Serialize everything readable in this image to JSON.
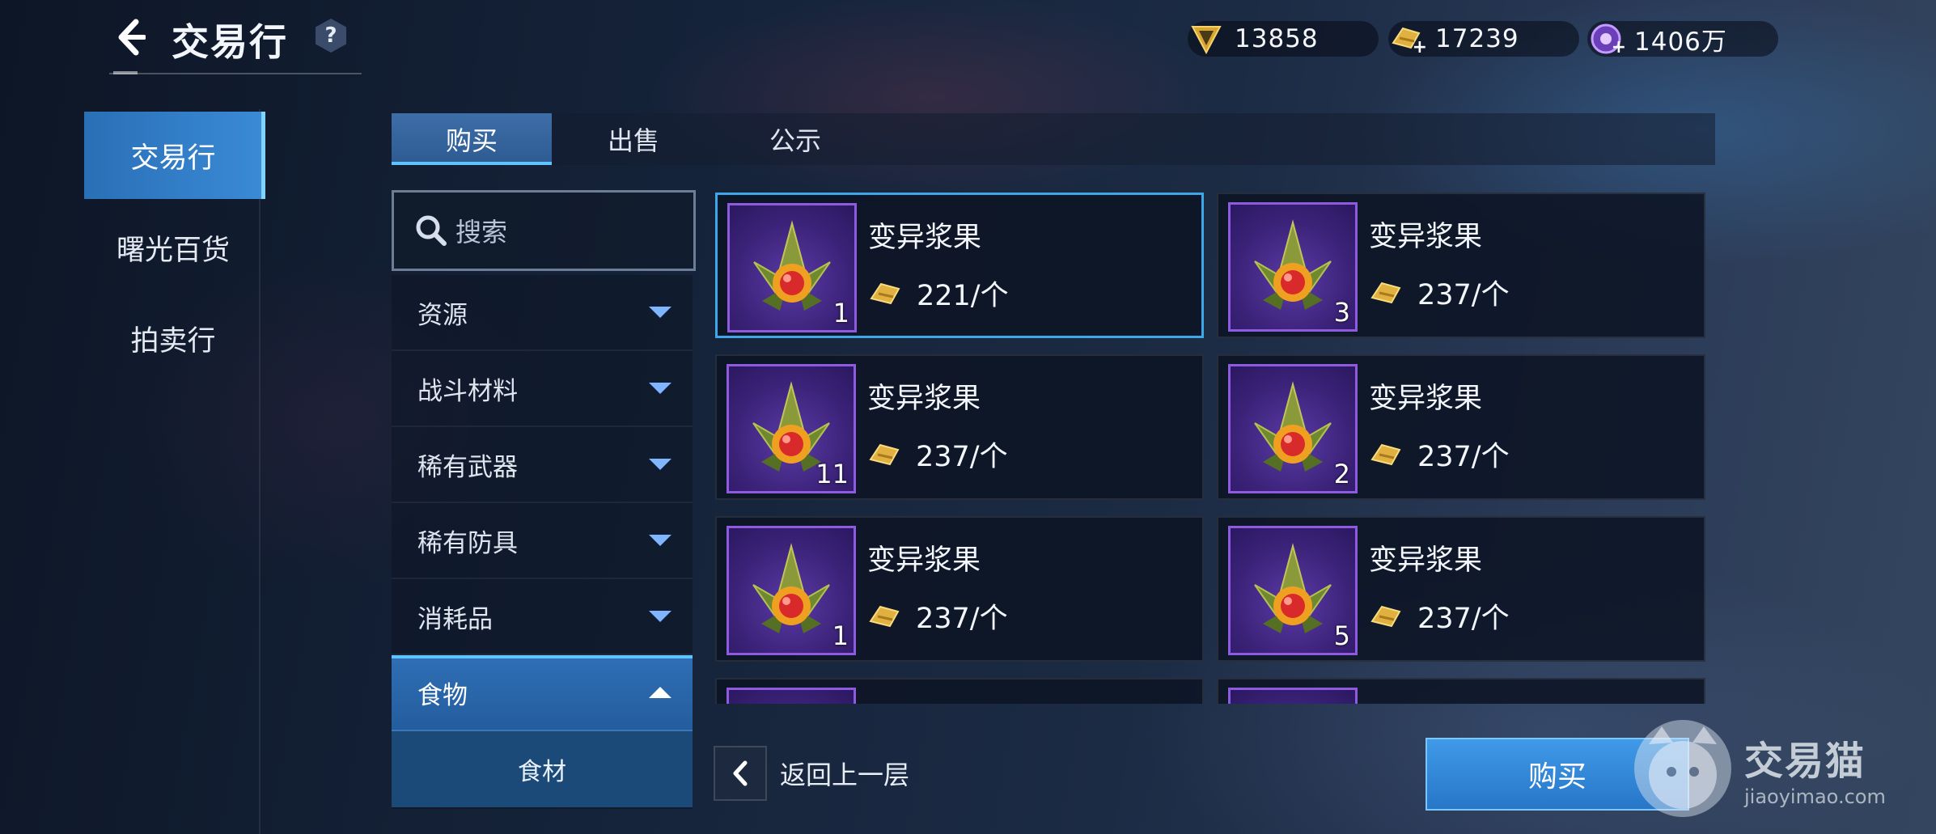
{
  "header": {
    "title": "交易行",
    "help_label": "?"
  },
  "currencies": [
    {
      "icon": "gold-triangle-coin-icon",
      "value": "13858",
      "has_plus": false
    },
    {
      "icon": "gold-bars-icon",
      "value": "17239",
      "has_plus": true
    },
    {
      "icon": "purple-crystal-icon",
      "value": "1406万",
      "has_plus": true
    }
  ],
  "sidebar": {
    "items": [
      {
        "label": "交易行",
        "active": true
      },
      {
        "label": "曙光百货",
        "active": false
      },
      {
        "label": "拍卖行",
        "active": false
      }
    ]
  },
  "tabs": [
    {
      "label": "购买",
      "active": true
    },
    {
      "label": "出售",
      "active": false
    },
    {
      "label": "公示",
      "active": false
    }
  ],
  "search": {
    "placeholder": "搜索"
  },
  "categories": [
    {
      "label": "资源",
      "expanded": false
    },
    {
      "label": "战斗材料",
      "expanded": false
    },
    {
      "label": "稀有武器",
      "expanded": false
    },
    {
      "label": "稀有防具",
      "expanded": false
    },
    {
      "label": "消耗品",
      "expanded": false
    },
    {
      "label": "食物",
      "expanded": true
    }
  ],
  "subcategory": {
    "label": "食材"
  },
  "listings": [
    {
      "name": "变异浆果",
      "price": "221/个",
      "qty": "1",
      "selected": true
    },
    {
      "name": "变异浆果",
      "price": "237/个",
      "qty": "3",
      "selected": false
    },
    {
      "name": "变异浆果",
      "price": "237/个",
      "qty": "11",
      "selected": false
    },
    {
      "name": "变异浆果",
      "price": "237/个",
      "qty": "2",
      "selected": false
    },
    {
      "name": "变异浆果",
      "price": "237/个",
      "qty": "1",
      "selected": false
    },
    {
      "name": "变异浆果",
      "price": "237/个",
      "qty": "5",
      "selected": false
    },
    {
      "name": "",
      "price": "",
      "qty": "",
      "selected": false
    },
    {
      "name": "",
      "price": "",
      "qty": "",
      "selected": false
    }
  ],
  "footer": {
    "back_label": "返回上一层",
    "buy_label": "购买"
  },
  "watermark": {
    "cn": "交易猫",
    "en": "jiaoyimao.com"
  },
  "colors": {
    "accent": "#3da7ea",
    "item_frame": "#8d5ae0",
    "gold": "#e0b040"
  }
}
